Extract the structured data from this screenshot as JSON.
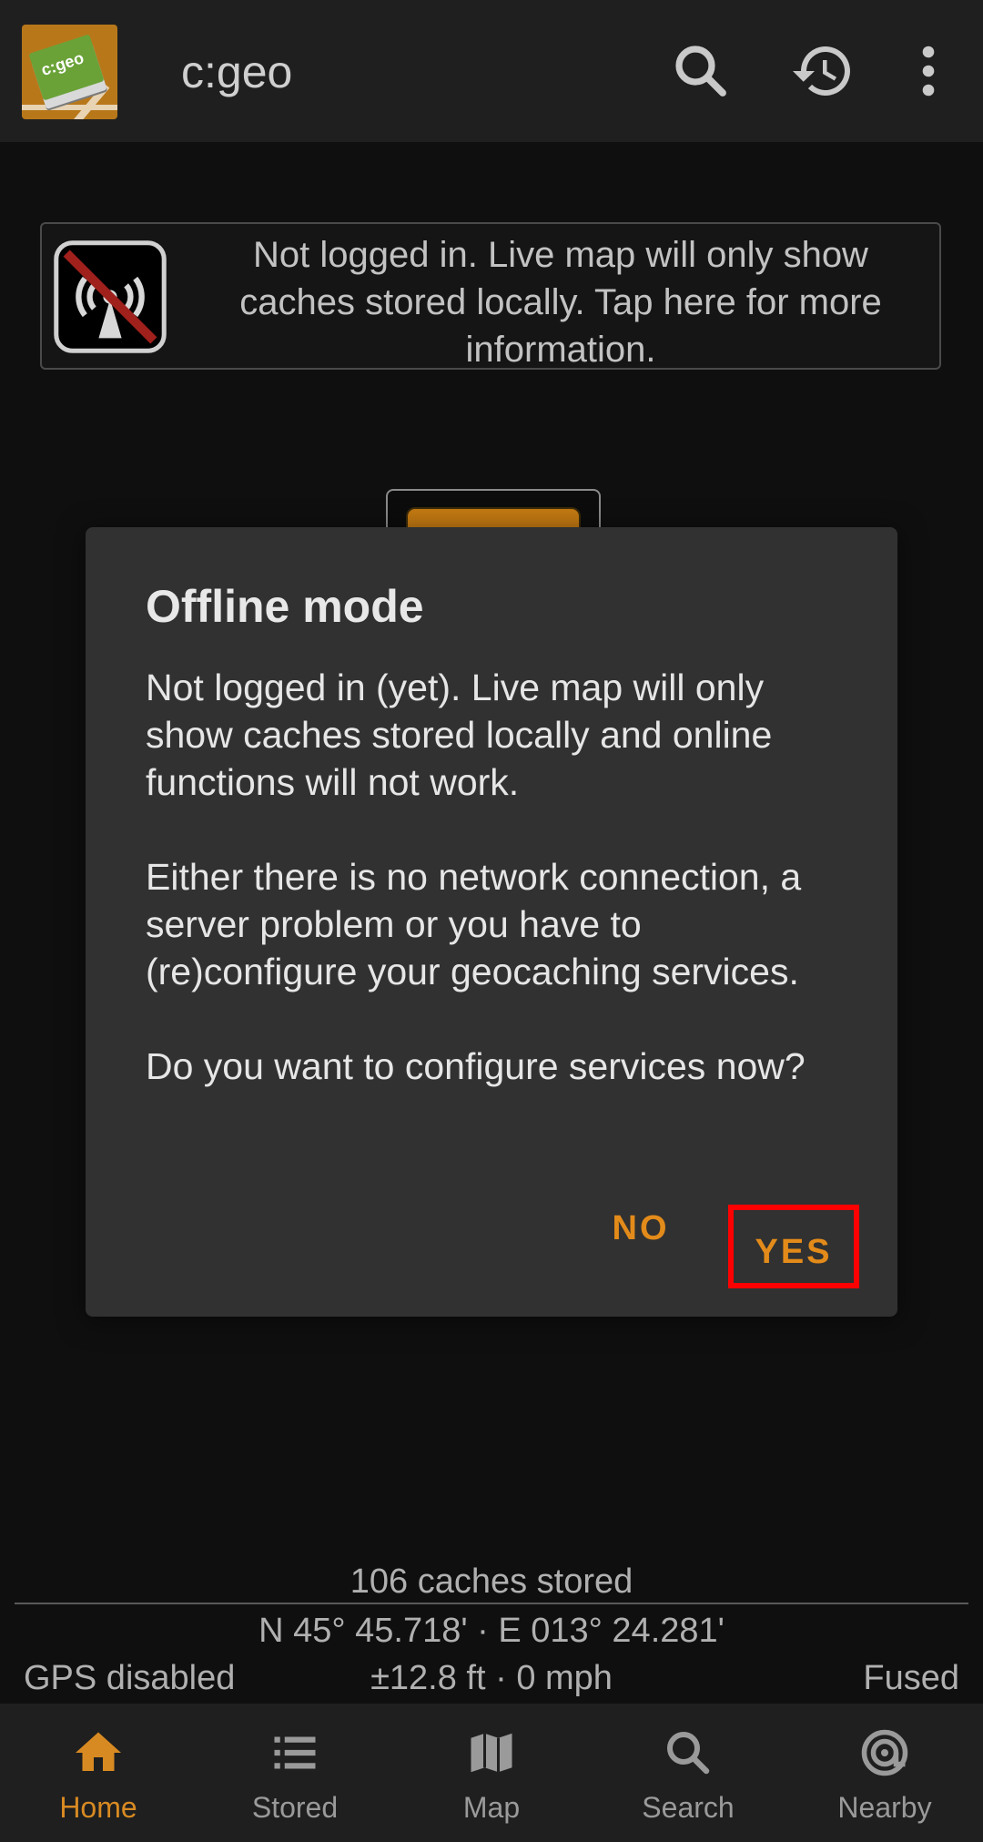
{
  "appbar": {
    "title": "c:geo",
    "logo_text": "c:geo",
    "icons": [
      "search-icon",
      "history-icon",
      "overflow-menu-icon"
    ]
  },
  "banner": {
    "text": "Not logged in. Live map will only show caches stored locally. Tap here for more information.",
    "icon": "no-signal-icon"
  },
  "dialog": {
    "title": "Offline mode",
    "paragraphs": [
      "Not logged in (yet). Live map will only show caches stored locally and online functions will not work.",
      "Either there is no network connection, a server problem or you have to (re)configure your geocaching services.",
      "Do you want to configure services now?"
    ],
    "no_label": "NO",
    "yes_label": "YES"
  },
  "status": {
    "caches_stored": "106 caches stored",
    "coordinates": "N 45° 45.718' · E 013° 24.281'",
    "gps": "GPS disabled",
    "accuracy_speed": "±12.8 ft · 0 mph",
    "provider": "Fused"
  },
  "bottom_nav": {
    "items": [
      {
        "label": "Home",
        "icon": "home-icon",
        "active": true
      },
      {
        "label": "Stored",
        "icon": "list-icon",
        "active": false
      },
      {
        "label": "Map",
        "icon": "map-icon",
        "active": false
      },
      {
        "label": "Search",
        "icon": "search-icon",
        "active": false
      },
      {
        "label": "Nearby",
        "icon": "nearby-icon",
        "active": false
      }
    ]
  },
  "colors": {
    "accent": "#e38b1a",
    "highlight_box": "#ff0000",
    "dialog_bg": "#313131",
    "bar_bg": "#1f1f1f"
  }
}
